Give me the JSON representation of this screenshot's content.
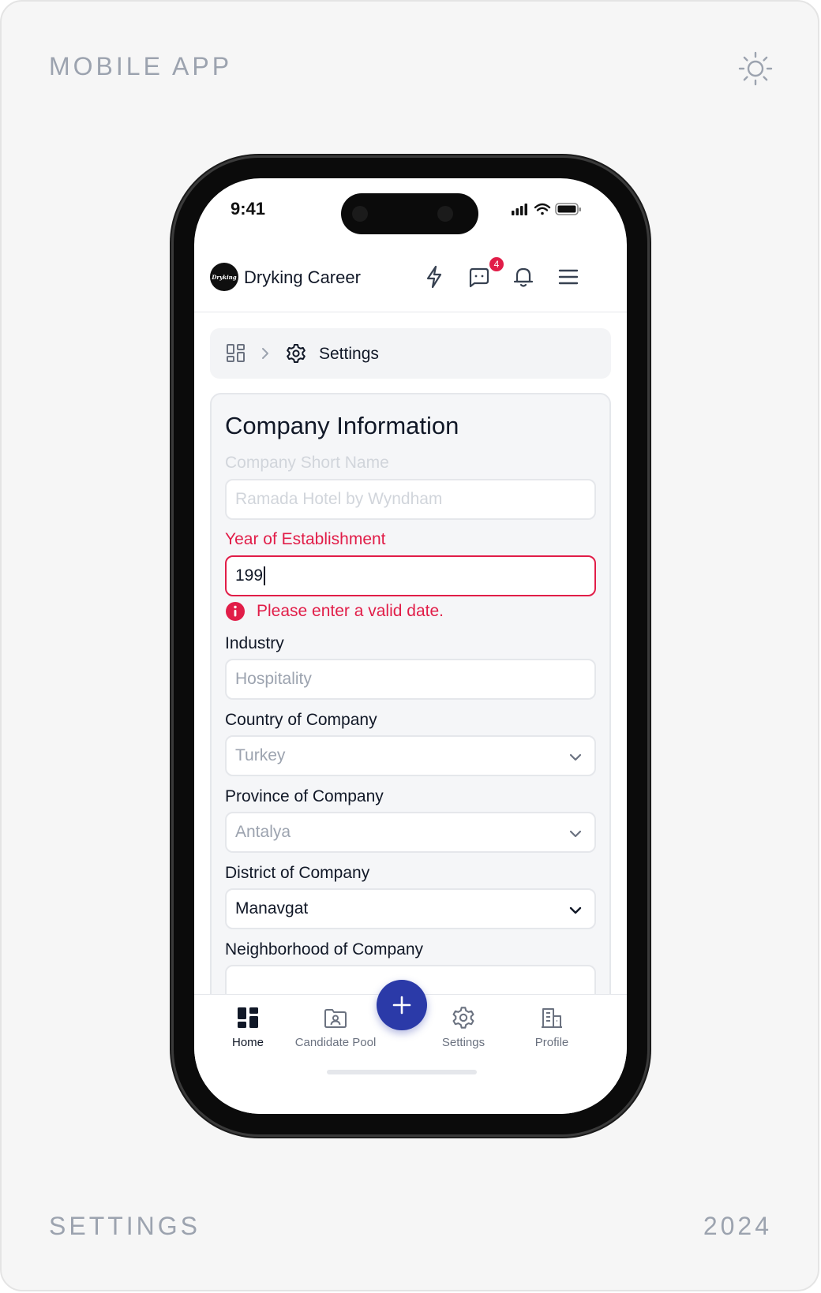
{
  "frame": {
    "top_left_label": "MOBILE APP",
    "bottom_left_label": "SETTINGS",
    "bottom_right_label": "2024"
  },
  "status_bar": {
    "time": "9:41"
  },
  "header": {
    "logo_text": "Dryking",
    "title": "Dryking Career",
    "message_badge_count": "4"
  },
  "breadcrumb": {
    "current_label": "Settings"
  },
  "form": {
    "title": "Company Information",
    "fields": [
      {
        "label": "Company Short Name",
        "value": "Ramada Hotel by Wyndham",
        "state": "disabled"
      },
      {
        "label": "Year of Establishment",
        "value": "199",
        "state": "error",
        "error_message": "Please enter a valid date."
      },
      {
        "label": "Industry",
        "value": "Hospitality",
        "state": "readonly"
      },
      {
        "label": "Country of Company",
        "value": "Turkey",
        "state": "select-muted"
      },
      {
        "label": "Province of Company",
        "value": "Antalya",
        "state": "select-muted"
      },
      {
        "label": "District of Company",
        "value": "Manavgat",
        "state": "select-active"
      },
      {
        "label": "Neighborhood of Company",
        "value": "",
        "state": "empty"
      }
    ]
  },
  "bottom_nav": {
    "items": [
      {
        "label": "Home",
        "active": true
      },
      {
        "label": "Candidate Pool",
        "active": false
      },
      {
        "label": "Settings",
        "active": false
      },
      {
        "label": "Profile",
        "active": false
      }
    ],
    "fab_symbol": "+"
  },
  "colors": {
    "error": "#e11d48",
    "fab": "#2b3aa8",
    "text": "#111827",
    "muted": "#9ca3af"
  }
}
